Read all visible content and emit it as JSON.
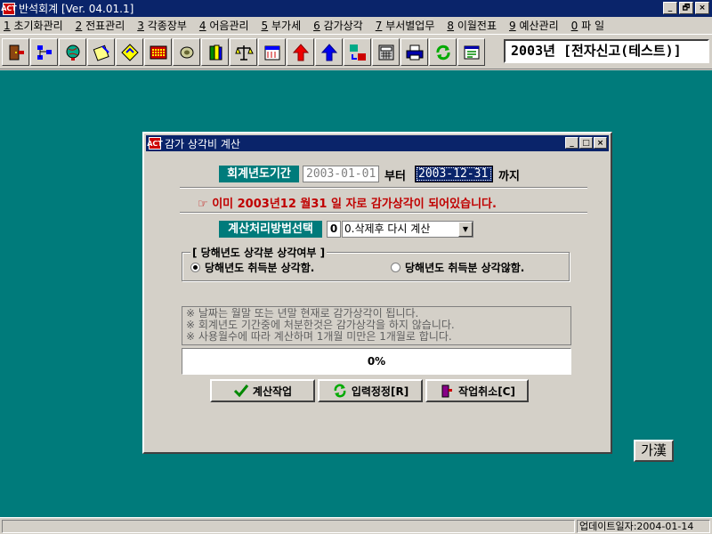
{
  "window": {
    "title": "반석회계 [Ver. 04.01.1]",
    "app_icon_text": "ACT",
    "controls": [
      "_",
      "🗗",
      "×"
    ]
  },
  "menu": [
    {
      "key": "1",
      "label": " 초기화관리"
    },
    {
      "key": "2",
      "label": " 전표관리"
    },
    {
      "key": "3",
      "label": " 각종장부"
    },
    {
      "key": "4",
      "label": " 어음관리"
    },
    {
      "key": "5",
      "label": " 부가세"
    },
    {
      "key": "6",
      "label": " 감가상각"
    },
    {
      "key": "7",
      "label": " 부서별업무"
    },
    {
      "key": "8",
      "label": " 이월전표"
    },
    {
      "key": "9",
      "label": " 예산관리"
    },
    {
      "key": "0",
      "label": " 파 일"
    }
  ],
  "toolbar": {
    "icons": [
      "exit-door-icon",
      "tree-icon",
      "globe-icon",
      "notepad-icon",
      "diamond-icon",
      "abacus-icon",
      "coin-icon",
      "books-icon",
      "scale-icon",
      "calendar-icon",
      "arrow-up-red-icon",
      "arrow-up-blue-icon",
      "exchange-icon",
      "calculator-icon",
      "printer-icon",
      "refresh-icon",
      "settings-icon"
    ],
    "period": "2003년  [전자신고(테스트)]"
  },
  "dialog": {
    "title": "감가 상각비 계산",
    "fiscal_label": "회계년도기간",
    "start_date": "2003-01-01",
    "from_text": "부터",
    "end_date": "2003-12-31",
    "to_text": "까지",
    "notice_icon": "☞",
    "notice": "이미 2003년12 월31 일 자로 감가상각이 되어있습니다.",
    "method_label": "계산처리방법선택",
    "method_code": "0",
    "method_value": "0.삭제후 다시 계산",
    "group_title": "[ 당해년도 상각분 상각여부 ]",
    "radio_yes": "당해년도 취득분 상각함.",
    "radio_no": "당해년도 취득분 상각않함.",
    "radio_selected": "yes",
    "info_lines": [
      "※ 날짜는 월말 또는 년말 현재로 감가상각이 됩니다.",
      "※ 회계년도 기간중에 처분한것은 감가상각을 하지 않습니다.",
      "※ 사용월수에 따라 계산하며 1개월 미만은 1개월로 합니다."
    ],
    "progress_text": "0%",
    "progress_value": 0,
    "btn_calc": "계산작업",
    "btn_reset": "입력정정[R]",
    "btn_cancel": "작업취소[C]"
  },
  "ime_button": "가漢",
  "status": {
    "update_date": "업데이트일자:2004-01-14"
  },
  "colors": {
    "title_bar": "#0a246a",
    "workspace": "#007b7b",
    "notice": "#c00000"
  }
}
